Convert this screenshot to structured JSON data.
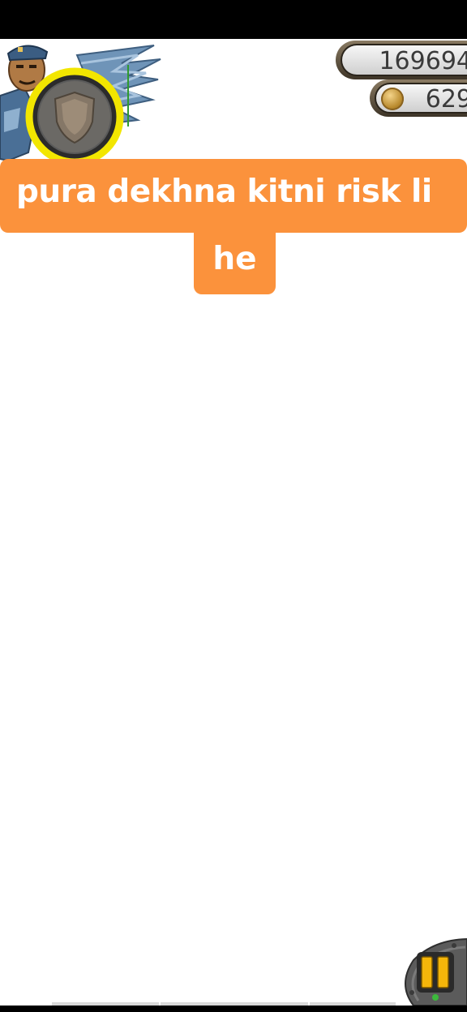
{
  "hud": {
    "score": "169694",
    "coins": "629",
    "coin_icon": "gold-coin-icon",
    "pause_icon": "pause-icon",
    "powerup_icon": "shield-icon",
    "character": "guard-character"
  },
  "caption": {
    "line1": "pura dekhna kitni risk li",
    "line2": "he"
  },
  "colors": {
    "caption_bg": "#fb923c",
    "caption_text": "#ffffff",
    "meter_ring": "#f2e600",
    "pause_accent": "#f5b60a"
  }
}
